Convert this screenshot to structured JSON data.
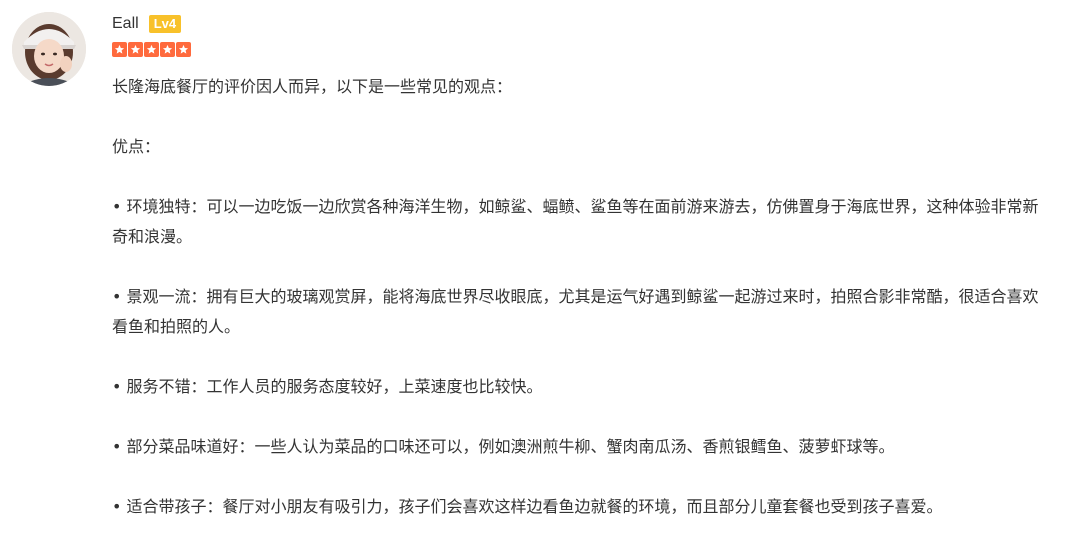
{
  "user": {
    "name": "Eall",
    "level": "Lv4"
  },
  "rating": {
    "stars": 5,
    "max": 5
  },
  "colors": {
    "star": "#ff6a3d",
    "level_badge": "#f8c12a",
    "text": "#333333"
  },
  "icons": {
    "avatar": "avatar-photo",
    "star": "star-icon"
  },
  "review": {
    "paragraphs": [
      "长隆海底餐厅的评价因人而异，以下是一些常见的观点：",
      "优点：",
      "• 环境独特：可以一边吃饭一边欣赏各种海洋生物，如鲸鲨、蝠鲼、鲨鱼等在面前游来游去，仿佛置身于海底世界，这种体验非常新奇和浪漫。",
      "• 景观一流：拥有巨大的玻璃观赏屏，能将海底世界尽收眼底，尤其是运气好遇到鲸鲨一起游过来时，拍照合影非常酷，很适合喜欢看鱼和拍照的人。",
      "• 服务不错：工作人员的服务态度较好，上菜速度也比较快。",
      "• 部分菜品味道好：一些人认为菜品的口味还可以，例如澳洲煎牛柳、蟹肉南瓜汤、香煎银鳕鱼、菠萝虾球等。",
      "• 适合带孩子：餐厅对小朋友有吸引力，孩子们会喜欢这样边看鱼边就餐的环境，而且部分儿童套餐也受到孩子喜爱。"
    ]
  }
}
